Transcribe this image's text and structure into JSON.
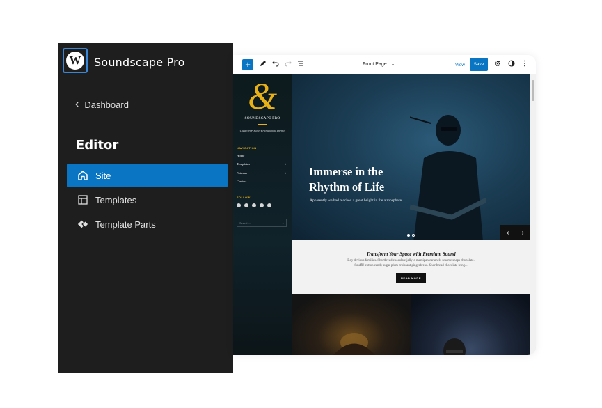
{
  "sidebar": {
    "logo_glyph": "W",
    "site_title": "Soundscape Pro",
    "back_label": "Dashboard",
    "heading": "Editor",
    "items": [
      {
        "label": "Site",
        "icon": "home-icon",
        "active": true
      },
      {
        "label": "Templates",
        "icon": "layout-icon",
        "active": false
      },
      {
        "label": "Template Parts",
        "icon": "symbol-icon",
        "active": false
      }
    ]
  },
  "toolbar": {
    "add_glyph": "+",
    "doc_title": "Front Page",
    "view_label": "View",
    "save_label": "Save"
  },
  "theme": {
    "logo_glyph": "&",
    "brand": "SOUNDSCAPE PRO",
    "tagline": "Clean WP Base/Framework Theme",
    "nav_heading": "NAVIGATION",
    "menu": [
      {
        "label": "Home",
        "sub": ""
      },
      {
        "label": "Templates",
        "sub": "+"
      },
      {
        "label": "Patterns",
        "sub": "+"
      },
      {
        "label": "Contact",
        "sub": ""
      }
    ],
    "follow_heading": "FOLLOW",
    "social_icons": [
      "facebook-icon",
      "twitter-icon",
      "bluesky-icon",
      "instagram-icon",
      "youtube-icon"
    ],
    "search_placeholder": "Search...",
    "search_glyph": "⌕"
  },
  "hero": {
    "title_line1": "Immerse in the",
    "title_line2": "Rhythm of Life",
    "subtitle": "Apparently we had reached a great height in the atmosphere",
    "prev": "‹",
    "next": "›"
  },
  "promo": {
    "title": "Transform Your Space with Premium Sound",
    "line1": "Boy devious families. Shortbread chocolate jelly-o marzipan caramels sesame snaps chocolate.",
    "line2": "Soufflé cotton candy sugar plum croissant gingerbread. Shortbread chocolate icing...",
    "button": "READ MORE"
  },
  "colors": {
    "accent": "#0a75c2",
    "sidebar_bg": "#1e1e1e",
    "gold": "#e8b117"
  }
}
